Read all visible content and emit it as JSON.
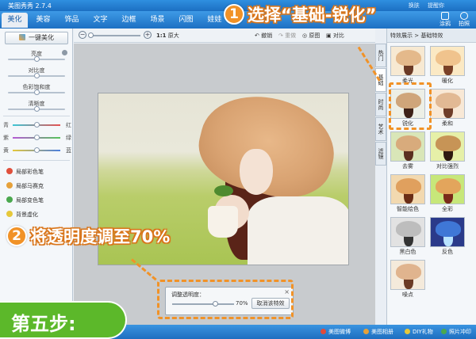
{
  "titlebar": {
    "title": "美图秀秀 2.7.4",
    "links": [
      "换肤",
      "提醒你"
    ]
  },
  "tabs": [
    "美化",
    "美容",
    "饰品",
    "文字",
    "边框",
    "场景",
    "闪图",
    "娃娃"
  ],
  "tools": [
    "涂鸦",
    "拍照"
  ],
  "left_panel": {
    "one_key": "一键美化",
    "sliders": [
      "亮度",
      "对比度",
      "色彩饱和度",
      "清晰度"
    ],
    "color_rows": [
      {
        "left": "青",
        "right": "红"
      },
      {
        "left": "紫",
        "right": "绿"
      },
      {
        "left": "黄",
        "right": "蓝"
      }
    ],
    "local_tools": [
      "局部彩色笔",
      "局部马赛克",
      "局部变色笔",
      "背景虚化"
    ]
  },
  "canvas_toolbar": {
    "ratio": "1:1",
    "original_size": "原大",
    "undo": "撤销",
    "redo": "重做",
    "original": "原图",
    "compare": "对比"
  },
  "dialog": {
    "title": "调整透明度：",
    "close": "×",
    "percent": "70%",
    "cancel": "取消该特效",
    "opacity_value": 0.7
  },
  "right_panel": {
    "header": "特效展示 > 基础特效",
    "vtabs": [
      "热门",
      "基础",
      "时尚",
      "艺术",
      "滤镜"
    ],
    "effects": [
      "柔光",
      "暖化",
      "锐化",
      "柔和",
      "去雾",
      "对比强烈",
      "智能绘色",
      "全彩",
      "黑白色",
      "反色",
      "噪点"
    ]
  },
  "statusbar": [
    "美图微博",
    "美图相册",
    "DIY礼物",
    "照片冲印"
  ],
  "overlays": {
    "step1_number": "1",
    "step1_text": "选择“基础-锐化”",
    "step2_number": "2",
    "step2_text": "将透明度调至70%",
    "step_label": "第五步:"
  },
  "colors": {
    "accent": "#f19227",
    "title_blue": "#1c6fc2",
    "step_green": "#5cb82a"
  }
}
